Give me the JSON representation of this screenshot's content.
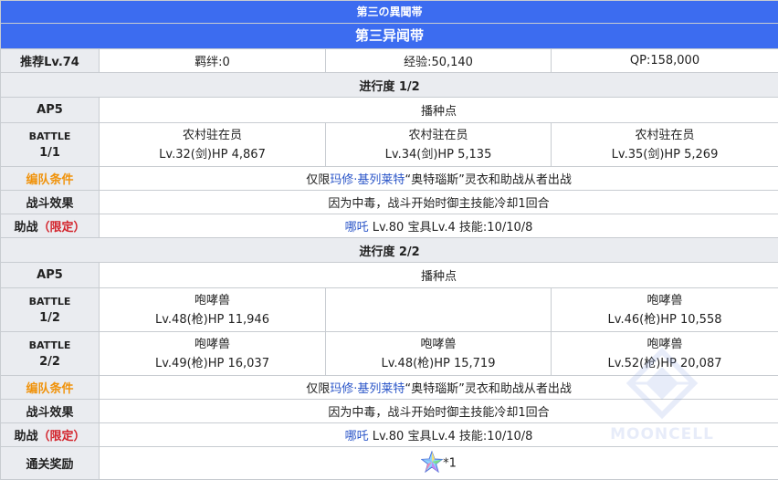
{
  "header": {
    "subtitle": "第三の異聞帯",
    "title": "第三异闻带"
  },
  "summary": {
    "recommended_level": "推荐Lv.74",
    "bond": "羁绊:0",
    "exp": "经验:50,140",
    "qp": "QP:158,000"
  },
  "colors": {
    "header_bg": "#3c6cf0",
    "label_bg": "#eaecf0",
    "orange": "#f0930c",
    "red": "#d3222a",
    "link": "#2a55c8"
  },
  "sections": [
    {
      "title": "进行度 1/2",
      "ap": {
        "label": "AP5",
        "value": "播种点"
      },
      "battles": [
        {
          "label": "BATTLE",
          "number": "1/1",
          "enemies": [
            {
              "name": "农村驻在员",
              "stats": "Lv.32(剑)HP 4,867"
            },
            {
              "name": "农村驻在员",
              "stats": "Lv.34(剑)HP 5,135"
            },
            {
              "name": "农村驻在员",
              "stats": "Lv.35(剑)HP 5,269"
            }
          ]
        }
      ],
      "party_condition": {
        "label": "编队条件",
        "prefix": "仅限",
        "servant": "玛修·基列莱特",
        "suffix": "“奥特瑙斯”灵衣和助战从者出战"
      },
      "battle_effect": {
        "label": "战斗效果",
        "value": "因为中毒，战斗开始时御主技能冷却1回合"
      },
      "support": {
        "label": "助战",
        "label_limited": "（限定）",
        "servant": "哪吒",
        "detail": " Lv.80 宝具Lv.4 技能:10/10/8"
      }
    },
    {
      "title": "进行度 2/2",
      "ap": {
        "label": "AP5",
        "value": "播种点"
      },
      "battles": [
        {
          "label": "BATTLE",
          "number": "1/2",
          "enemies": [
            {
              "name": "咆哮兽",
              "stats": "Lv.48(枪)HP 11,946"
            },
            {
              "name": "",
              "stats": ""
            },
            {
              "name": "咆哮兽",
              "stats": "Lv.46(枪)HP 10,558"
            }
          ]
        },
        {
          "label": "BATTLE",
          "number": "2/2",
          "enemies": [
            {
              "name": "咆哮兽",
              "stats": "Lv.49(枪)HP 16,037"
            },
            {
              "name": "咆哮兽",
              "stats": "Lv.48(枪)HP 15,719"
            },
            {
              "name": "咆哮兽",
              "stats": "Lv.52(枪)HP 20,087"
            }
          ]
        }
      ],
      "party_condition": {
        "label": "编队条件",
        "prefix": "仅限",
        "servant": "玛修·基列莱特",
        "suffix": "“奥特瑙斯”灵衣和助战从者出战"
      },
      "battle_effect": {
        "label": "战斗效果",
        "value": "因为中毒，战斗开始时御主技能冷却1回合"
      },
      "support": {
        "label": "助战",
        "label_limited": "（限定）",
        "servant": "哪吒",
        "detail": " Lv.80 宝具Lv.4 技能:10/10/8"
      }
    }
  ],
  "reward": {
    "label": "通关奖励",
    "icon": "saint-quartz-icon",
    "count": "*1"
  },
  "watermark": {
    "text": "MOONCELL"
  }
}
